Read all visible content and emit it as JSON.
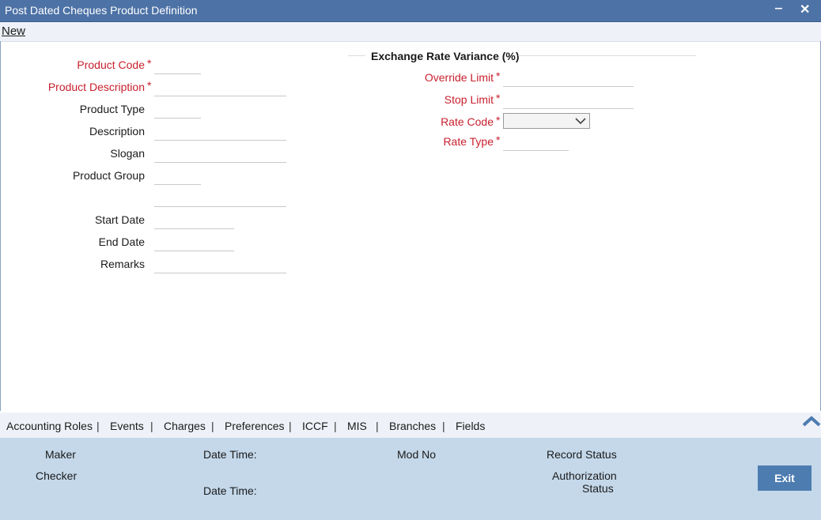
{
  "window": {
    "title": "Post Dated Cheques Product Definition",
    "minimize_glyph": "‒",
    "close_glyph": "✕"
  },
  "menu": {
    "new_label": "New"
  },
  "form": {
    "product_code": "Product Code",
    "product_description": "Product Description",
    "product_type": "Product Type",
    "description": "Description",
    "slogan": "Slogan",
    "product_group": "Product Group",
    "start_date": "Start Date",
    "end_date": "End Date",
    "remarks": "Remarks",
    "required_mark": "*"
  },
  "exchange": {
    "heading": "Exchange Rate Variance (%)",
    "override_limit": "Override Limit",
    "stop_limit": "Stop Limit",
    "rate_code": "Rate Code",
    "rate_type": "Rate Type"
  },
  "tabs": {
    "accounting_roles": "Accounting Roles",
    "events": "Events",
    "charges": "Charges",
    "preferences": "Preferences",
    "iccf": "ICCF",
    "mis": "MIS",
    "branches": "Branches",
    "fields": "Fields",
    "separator": "|"
  },
  "footer": {
    "maker": "Maker",
    "checker": "Checker",
    "date_time": "Date Time:",
    "mod_no": "Mod No",
    "record_status": "Record Status",
    "authorization": "Authorization",
    "status": "Status",
    "exit_label": "Exit"
  },
  "colors": {
    "titlebar": "#4d72a6",
    "required": "#c8202e",
    "footer": "#c4d8ea",
    "exit_button": "#4d7cb0"
  },
  "icons": {
    "minimize": "minimize-icon",
    "close": "close-icon",
    "select_arrow": "chevron-down-icon",
    "collapse": "chevron-up-icon"
  }
}
